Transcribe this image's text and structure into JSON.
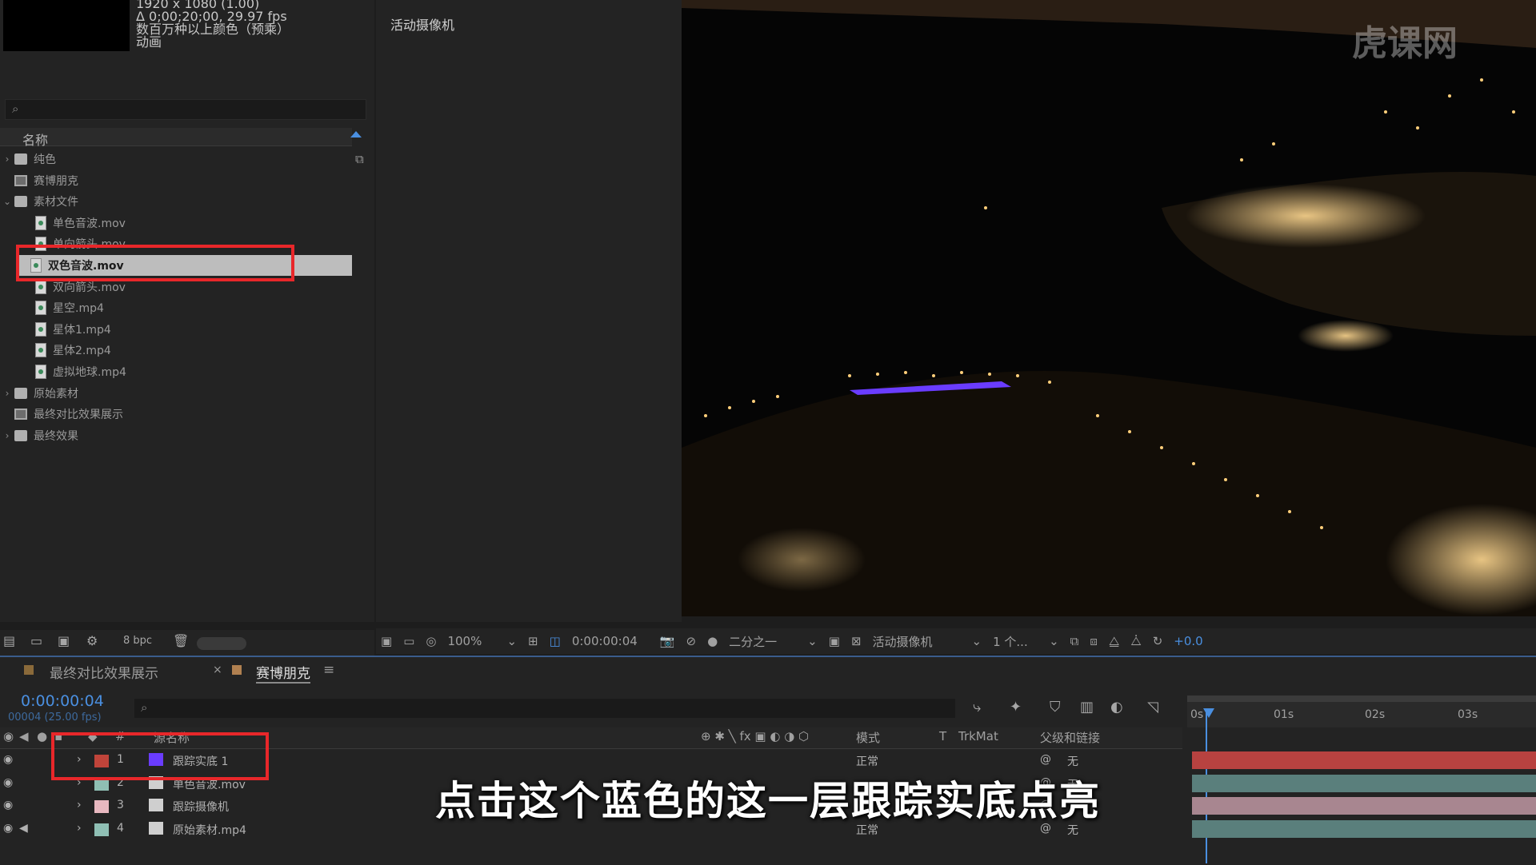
{
  "project": {
    "meta_line1": "1920 x 1080 (1.00)",
    "meta_line2": "Δ 0;00;20;00, 29.97 fps",
    "meta_line3": "数百万种以上颜色（预乘）",
    "meta_line4": "动画",
    "column_name": "名称",
    "items": [
      {
        "label": "纯色",
        "kind": "folder",
        "twisty": "›"
      },
      {
        "label": "赛博朋克",
        "kind": "comp",
        "twisty": ""
      },
      {
        "label": "素材文件",
        "kind": "folder",
        "twisty": "⌄"
      },
      {
        "label": "单色音波.mov",
        "kind": "file",
        "twisty": ""
      },
      {
        "label": "单向箭头.mov",
        "kind": "file",
        "twisty": ""
      },
      {
        "label": "双色音波.mov",
        "kind": "file",
        "twisty": ""
      },
      {
        "label": "双向箭头.mov",
        "kind": "file",
        "twisty": ""
      },
      {
        "label": "星空.mp4",
        "kind": "file",
        "twisty": ""
      },
      {
        "label": "星体1.mp4",
        "kind": "file",
        "twisty": ""
      },
      {
        "label": "星体2.mp4",
        "kind": "file",
        "twisty": ""
      },
      {
        "label": "虚拟地球.mp4",
        "kind": "file",
        "twisty": ""
      },
      {
        "label": "原始素材",
        "kind": "folder",
        "twisty": "›"
      },
      {
        "label": "最终对比效果展示",
        "kind": "comp",
        "twisty": ""
      },
      {
        "label": "最终效果",
        "kind": "folder",
        "twisty": "›"
      }
    ],
    "bpc": "8 bpc"
  },
  "viewer": {
    "camera_label": "活动摄像机",
    "watermark": "虎课网",
    "zoom": "100%",
    "timecode": "0:00:00:04",
    "resolution": "二分之一",
    "view": "活动摄像机",
    "views_count": "1 个...",
    "exposure": "+0.0"
  },
  "timeline": {
    "tab1": "最终对比效果展示",
    "tab2": "赛博朋克",
    "timecode": "0:00:00:04",
    "frame_info": "00004 (25.00 fps)",
    "col_source": "源名称",
    "col_mode": "模式",
    "col_t": "T",
    "col_trkmat": "TrkMat",
    "col_parent": "父级和链接",
    "ruler": [
      "0s",
      "01s",
      "02s",
      "03s"
    ],
    "layers": [
      {
        "num": "1",
        "name": "跟踪实底 1",
        "mode": "正常",
        "parent": "无",
        "label_color": "#c0443a",
        "track_color": "#b84240"
      },
      {
        "num": "2",
        "name": "单色音波.mov",
        "mode": "",
        "parent": "无",
        "label_color": "#8fbfb4",
        "track_color": "#5a7f7c"
      },
      {
        "num": "3",
        "name": "跟踪摄像机",
        "mode": "",
        "parent": "",
        "label_color": "#e8b8c0",
        "track_color": "#a88690"
      },
      {
        "num": "4",
        "name": "原始素材.mp4",
        "mode": "正常",
        "parent": "无",
        "label_color": "#8fbfb4",
        "track_color": "#5a7f7c"
      }
    ]
  },
  "subtitle": "点击这个蓝色的这一层跟踪实底点亮"
}
